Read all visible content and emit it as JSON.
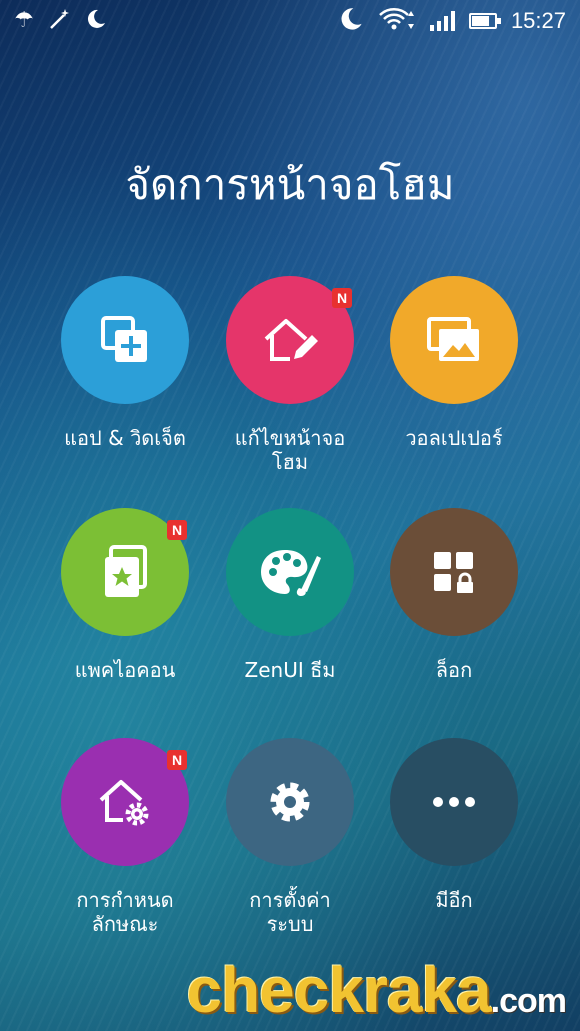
{
  "status_bar": {
    "left_icons": [
      "umbrella-icon",
      "magic-wand-icon",
      "moon-icon"
    ],
    "right_icons": [
      "moon-icon",
      "wifi-icon",
      "signal-icon",
      "battery-icon"
    ],
    "time": "15:27"
  },
  "title": "จัดการหน้าจอโฮม",
  "tiles": [
    {
      "label": "แอป & วิดเจ็ต",
      "color": "#2c9fd8",
      "icon": "add-apps-icon",
      "badge": ""
    },
    {
      "label": "แก้ไขหน้าจอ\nโฮม",
      "color": "#e5356a",
      "icon": "edit-home-icon",
      "badge": "N"
    },
    {
      "label": "วอลเปเปอร์",
      "color": "#f1a92a",
      "icon": "wallpaper-icon",
      "badge": ""
    },
    {
      "label": "แพคไอคอน",
      "color": "#7cbf35",
      "icon": "icon-pack-icon",
      "badge": "N"
    },
    {
      "label": "ZenUI ธีม",
      "color": "#129284",
      "icon": "palette-icon",
      "badge": ""
    },
    {
      "label": "ล็อก",
      "color": "#6b4e38",
      "icon": "app-lock-icon",
      "badge": ""
    },
    {
      "label": "การกำหนด\nลักษณะ",
      "color": "#9a2fb0",
      "icon": "home-settings-icon",
      "badge": "N"
    },
    {
      "label": "การตั้งค่า\nระบบ",
      "color": "#3d6682",
      "icon": "gear-icon",
      "badge": ""
    },
    {
      "label": "มีอีก",
      "color": "#284e63",
      "icon": "more-icon",
      "badge": ""
    }
  ],
  "watermark": {
    "brand": "checkraka",
    "suffix": ".com"
  }
}
